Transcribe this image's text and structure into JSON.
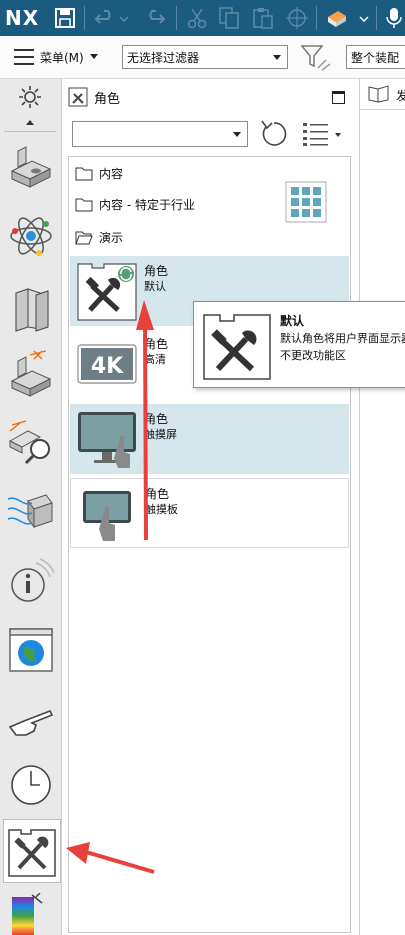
{
  "titlebar": {
    "logo": "NX",
    "icons": [
      "save-icon",
      "undo-icon",
      "redo-icon",
      "cut-icon",
      "copy-icon",
      "paste-icon",
      "snap-icon",
      "render-icon",
      "microphone-icon"
    ]
  },
  "commandbar": {
    "menu_label": "菜单(M)",
    "filter_value": "无选择过滤器",
    "assembly_value": "整个装配"
  },
  "leftbar": {
    "items": [
      "settings-icon",
      "part-icon",
      "physics-icon",
      "books-icon",
      "dimension-icon",
      "inspect-icon",
      "flow-icon",
      "info-icon",
      "web-icon",
      "touch-icon",
      "clock-icon",
      "roles-icon",
      "palette-icon"
    ]
  },
  "panel": {
    "title": "角色",
    "role_dropdown_value": "",
    "folders": [
      "内容",
      "内容 - 特定于行业",
      "演示"
    ],
    "roles": [
      {
        "name": "角色",
        "sub": "默认",
        "icon": "tools-icon"
      },
      {
        "name": "角色",
        "sub": "高清",
        "icon": "4k-icon"
      },
      {
        "name": "角色",
        "sub": "触摸屏",
        "icon": "touchscreen-icon"
      },
      {
        "name": "角色",
        "sub": "触摸板",
        "icon": "touchpad-icon"
      }
    ]
  },
  "right": {
    "tab_label": "发"
  },
  "tooltip": {
    "title": "默认",
    "desc": "默认角色将用户界面显示器。该角色不更改功能区"
  },
  "colors": {
    "titlebar": "#1c5b80",
    "selection": "#d5e7ed",
    "annotation_arrow": "#e8403a"
  }
}
